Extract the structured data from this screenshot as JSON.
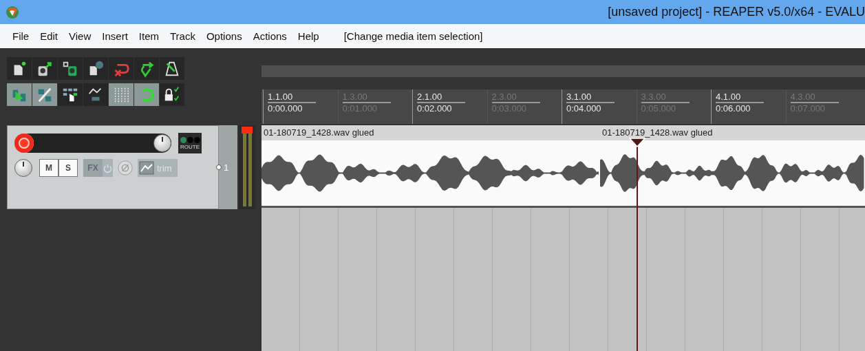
{
  "window": {
    "title": "[unsaved project] - REAPER v5.0/x64 - EVALU"
  },
  "menu": {
    "items": [
      "File",
      "Edit",
      "View",
      "Insert",
      "Item",
      "Track",
      "Options",
      "Actions",
      "Help"
    ],
    "status": "[Change media item selection]"
  },
  "toolbar": {
    "rows": [
      [
        {
          "on": false
        },
        {
          "on": false
        },
        {
          "on": false
        },
        {
          "on": false
        },
        {
          "on": false
        },
        {
          "on": false
        },
        {
          "on": false
        }
      ],
      [
        {
          "on": true
        },
        {
          "on": true
        },
        {
          "on": false
        },
        {
          "on": false
        },
        {
          "on": true
        },
        {
          "on": true
        },
        {
          "on": false
        }
      ]
    ]
  },
  "track": {
    "number": "1",
    "record_armed": true,
    "route": "ROUTE",
    "mute": {
      "label": "M",
      "on": false
    },
    "solo": {
      "label": "S",
      "on": false
    },
    "fx": {
      "label": "FX",
      "on": false
    },
    "trim": "trim",
    "clipped": true
  },
  "ruler": {
    "ticks": [
      {
        "kind": "major",
        "bar": "1.1.00",
        "time": "0:00.000"
      },
      {
        "kind": "minor",
        "bar": "1.3.00",
        "time": "0:01.000"
      },
      {
        "kind": "major",
        "bar": "2.1.00",
        "time": "0:02.000"
      },
      {
        "kind": "minor",
        "bar": "2.3.00",
        "time": "0:03.000"
      },
      {
        "kind": "major",
        "bar": "3.1.00",
        "time": "0:04.000"
      },
      {
        "kind": "minor",
        "bar": "3.3.00",
        "time": "0:05.000"
      },
      {
        "kind": "major",
        "bar": "4.1.00",
        "time": "0:06.000"
      },
      {
        "kind": "minor",
        "bar": "4.3.00",
        "time": "0:07.000"
      }
    ]
  },
  "playhead": {
    "level": 0.6226
  },
  "items": [
    {
      "name": "01-180719_1428.wav glued"
    },
    {
      "name": "01-180719_1428.wav glued"
    }
  ]
}
